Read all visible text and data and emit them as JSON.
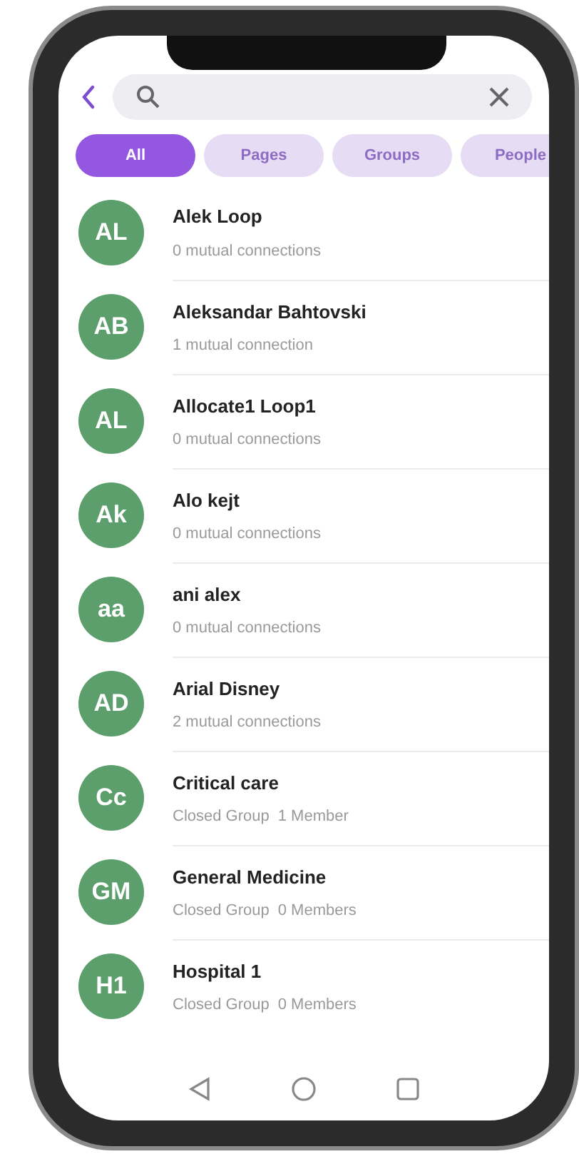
{
  "filters": [
    {
      "label": "All",
      "selected": true
    },
    {
      "label": "Pages",
      "selected": false
    },
    {
      "label": "Groups",
      "selected": false
    },
    {
      "label": "People",
      "selected": false
    }
  ],
  "results": [
    {
      "kind": "person",
      "initials": "AL",
      "name": "Alek Loop",
      "detail": "0 mutual connections"
    },
    {
      "kind": "person",
      "initials": "AB",
      "name": "Aleksandar Bahtovski",
      "detail": "1 mutual connection"
    },
    {
      "kind": "person",
      "initials": "AL",
      "name": "Allocate1 Loop1",
      "detail": "0 mutual connections"
    },
    {
      "kind": "person",
      "initials": "Ak",
      "name": "Alo kejt",
      "detail": "0 mutual connections"
    },
    {
      "kind": "person",
      "initials": "aa",
      "name": "ani alex",
      "detail": "0 mutual connections"
    },
    {
      "kind": "person",
      "initials": "AD",
      "name": "Arial Disney",
      "detail": "2 mutual connections"
    },
    {
      "kind": "group",
      "initials": "Cc",
      "name": "Critical care",
      "privacy": "Closed Group",
      "members": "1 Member"
    },
    {
      "kind": "group",
      "initials": "GM",
      "name": "General Medicine",
      "privacy": "Closed Group",
      "members": "0 Members"
    },
    {
      "kind": "group",
      "initials": "H1",
      "name": "Hospital 1",
      "privacy": "Closed Group",
      "members": "0 Members"
    }
  ]
}
